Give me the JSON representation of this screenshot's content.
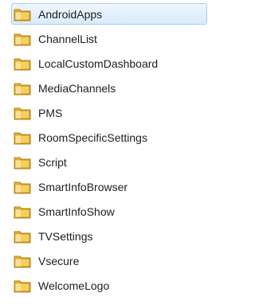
{
  "folders": [
    {
      "label": "AndroidApps",
      "selected": true
    },
    {
      "label": "ChannelList",
      "selected": false
    },
    {
      "label": "LocalCustomDashboard",
      "selected": false
    },
    {
      "label": "MediaChannels",
      "selected": false
    },
    {
      "label": "PMS",
      "selected": false
    },
    {
      "label": "RoomSpecificSettings",
      "selected": false
    },
    {
      "label": "Script",
      "selected": false
    },
    {
      "label": "SmartInfoBrowser",
      "selected": false
    },
    {
      "label": "SmartInfoShow",
      "selected": false
    },
    {
      "label": "TVSettings",
      "selected": false
    },
    {
      "label": "Vsecure",
      "selected": false
    },
    {
      "label": "WelcomeLogo",
      "selected": false
    }
  ],
  "icon": "folder-icon",
  "colors": {
    "selection_fill": "#d9ebfb",
    "selection_border": "#a7cdf0",
    "folder_yellow": "#f0c24a",
    "text": "#1e1e1e"
  }
}
